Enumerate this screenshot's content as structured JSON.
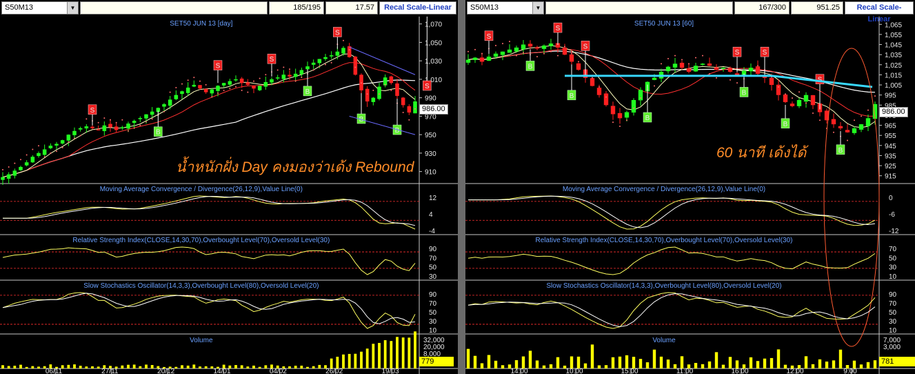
{
  "panels": [
    {
      "symbol": "S50M13",
      "counter": "185/195",
      "last_value": "17.57",
      "recal_label": "Recal Scale-Linear",
      "price_title": "SET50 JUN 13   [day]",
      "annotation": "น้ำหนักฝั่ง Day คงมองว่าเด้ง Rebound",
      "price_marker": "986.00",
      "volume_marker": "779",
      "indicator_titles": [
        "Moving Average Convergence / Divergence(26,12,9),Value Line(0)",
        "Relative Strength Index(CLOSE,14,30,70),Overbought Level(70),Oversold Level(30)",
        "Slow Stochastics Oscillator(14,3,3),Overbought Level(80),Oversold Level(20)",
        "Volume"
      ],
      "date_labels": [
        "06/11",
        "27/11",
        "20/12",
        "14/01",
        "04/02",
        "26/02",
        "19/03"
      ],
      "chart_data": {
        "type": "candlestick",
        "price_ticks": [
          "1,070",
          "1,050",
          "1,030",
          "1,010",
          "990",
          "970",
          "950",
          "930",
          "910"
        ],
        "ylim": [
          900,
          1075
        ],
        "macd_ticks": [
          "12",
          "4",
          "-4"
        ],
        "rsi_ticks": [
          "90",
          "70",
          "50",
          "30"
        ],
        "stoch_ticks": [
          "90",
          "70",
          "50",
          "30",
          "10"
        ],
        "volume_ticks": [
          "32,000",
          "20,000",
          "8,000"
        ],
        "close_path": [
          904,
          907,
          911,
          915,
          920,
          926,
          930,
          934,
          938,
          940,
          944,
          950,
          954,
          957,
          959,
          957,
          955,
          960,
          958,
          955,
          958,
          962,
          965,
          968,
          972,
          975,
          979,
          983,
          988,
          993,
          997,
          1001,
          1004,
          1000,
          996,
          999,
          1003,
          1006,
          1008,
          1010,
          1006,
          1004,
          1000,
          1003,
          1007,
          1010,
          1012,
          1015,
          1013,
          1016,
          1020,
          1024,
          1028,
          1032,
          1034,
          1036,
          1040,
          1044,
          1034,
          1015,
          998,
          986,
          990,
          1002,
          1012,
          1006,
          992,
          982,
          974,
          986
        ],
        "signals_s": [
          15,
          36,
          45,
          56,
          71
        ],
        "signals_b": [
          26,
          51,
          60,
          66
        ]
      }
    },
    {
      "symbol": "S50M13",
      "counter": "167/300",
      "last_value": "951.25",
      "recal_label": "Recal Scale-Linear",
      "price_title": "SET50 JUN 13    [60]",
      "annotation": "60 นาที เด้งได้",
      "price_marker": "986.00",
      "volume_marker": "781",
      "indicator_titles": [
        "Moving Average Convergence / Divergence(26,12,9),Value Line(0)",
        "Relative Strength Index(CLOSE,14,30,70),Overbought Level(70),Oversold Level(30)",
        "Slow Stochastics Oscillator(14,3,3),Overbought Level(80),Oversold Level(20)",
        "Volume"
      ],
      "date_labels": [
        "14:00",
        "10:00",
        "15:00",
        "11:00",
        "16:00",
        "12:00",
        "9:00"
      ],
      "chart_data": {
        "type": "candlestick",
        "price_ticks": [
          "1,065",
          "1,055",
          "1,045",
          "1,035",
          "1,025",
          "1,015",
          "1,005",
          "995",
          "985",
          "975",
          "965",
          "955",
          "945",
          "935",
          "925",
          "915"
        ],
        "ylim": [
          910,
          1070
        ],
        "macd_ticks": [
          "0",
          "-6",
          "-12"
        ],
        "rsi_ticks": [
          "70",
          "50",
          "30",
          "10"
        ],
        "stoch_ticks": [
          "90",
          "70",
          "50",
          "30",
          "10"
        ],
        "volume_ticks": [
          "7,000",
          "3,000"
        ],
        "close_path": [
          1030,
          1032,
          1028,
          1033,
          1036,
          1038,
          1040,
          1042,
          1045,
          1043,
          1041,
          1044,
          1046,
          1042,
          1035,
          1028,
          1020,
          1012,
          1004,
          995,
          985,
          976,
          972,
          978,
          990,
          1000,
          1008,
          1012,
          1018,
          1023,
          1026,
          1022,
          1018,
          1024,
          1026,
          1024,
          1020,
          1022,
          1018,
          1015,
          1019,
          1022,
          1016,
          1012,
          1005,
          995,
          988,
          984,
          990,
          995,
          985,
          978,
          970,
          966,
          962,
          958,
          962,
          966,
          972,
          986
        ],
        "signals_s": [
          3,
          13,
          17,
          39,
          43,
          51
        ],
        "signals_b": [
          9,
          15,
          26,
          40,
          46,
          54
        ]
      }
    }
  ]
}
